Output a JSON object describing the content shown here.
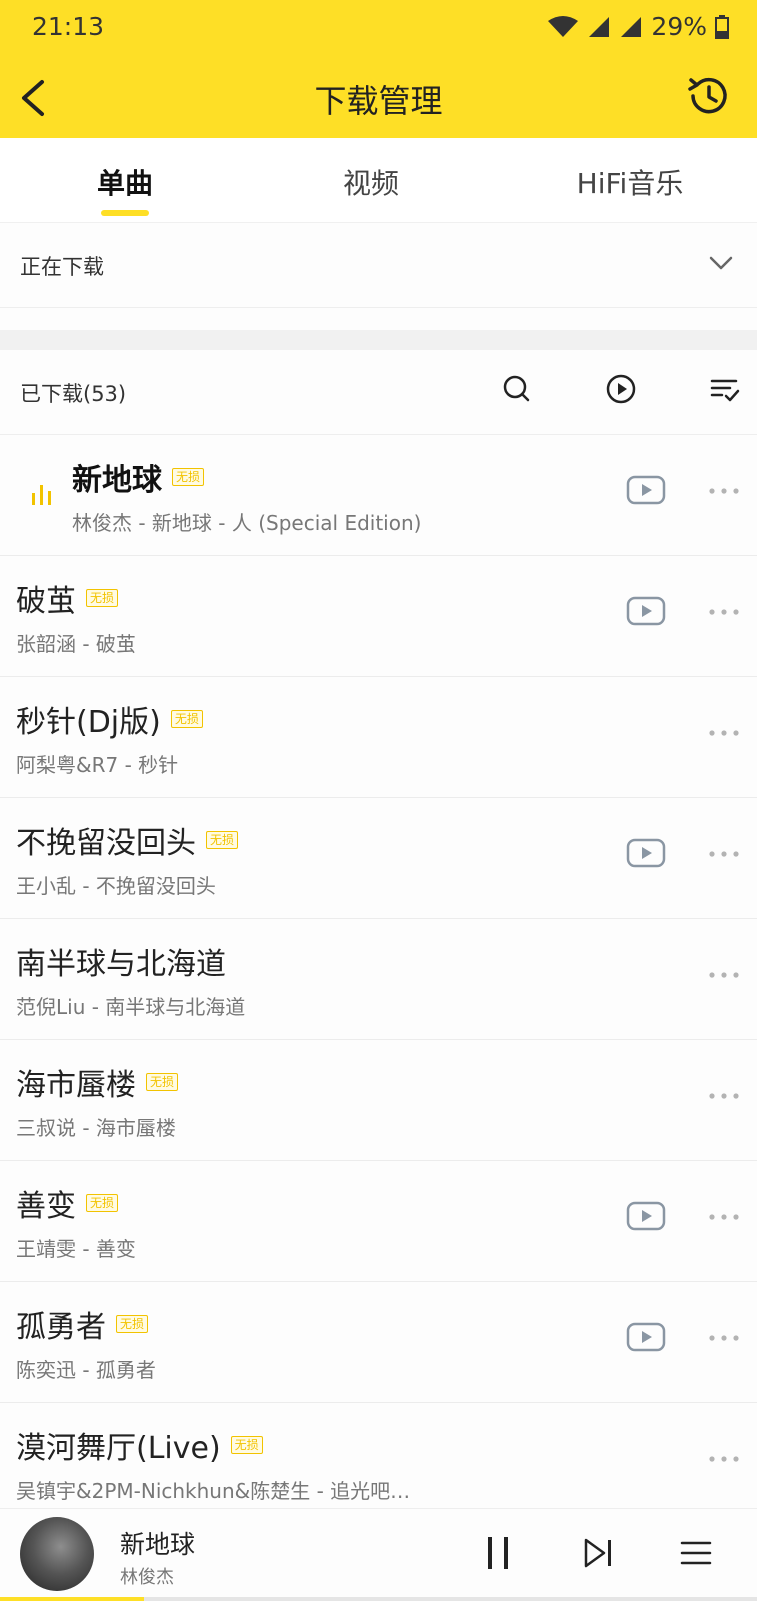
{
  "status": {
    "time": "21:13",
    "battery": "29%"
  },
  "header": {
    "title": "下载管理",
    "back_icon": "chevron-left-icon",
    "history_icon": "history-icon"
  },
  "tabs": [
    {
      "label": "单曲",
      "active": true
    },
    {
      "label": "视频",
      "active": false
    },
    {
      "label": "HiFi音乐",
      "active": false
    }
  ],
  "downloading": {
    "label": "正在下载"
  },
  "downloaded": {
    "label": "已下载(53)"
  },
  "badge_label": "无损",
  "songs": [
    {
      "title": "新地球",
      "lossless": true,
      "subtitle": "林俊杰 - 新地球 - 人 (Special Edition)",
      "mv": true,
      "playing": true
    },
    {
      "title": "破茧",
      "lossless": true,
      "subtitle": "张韶涵 - 破茧",
      "mv": true,
      "playing": false
    },
    {
      "title": "秒针(Dj版)",
      "lossless": true,
      "subtitle": "阿梨粤&R7 - 秒针",
      "mv": false,
      "playing": false
    },
    {
      "title": "不挽留没回头",
      "lossless": true,
      "subtitle": "王小乱 - 不挽留没回头",
      "mv": true,
      "playing": false
    },
    {
      "title": "南半球与北海道",
      "lossless": false,
      "subtitle": "范倪Liu - 南半球与北海道",
      "mv": false,
      "playing": false
    },
    {
      "title": "海市蜃楼",
      "lossless": true,
      "subtitle": "三叔说 - 海市蜃楼",
      "mv": false,
      "playing": false
    },
    {
      "title": "善变",
      "lossless": true,
      "subtitle": "王靖雯 - 善变",
      "mv": true,
      "playing": false
    },
    {
      "title": "孤勇者",
      "lossless": true,
      "subtitle": "陈奕迅 - 孤勇者",
      "mv": true,
      "playing": false
    },
    {
      "title": "漠河舞厅(Live)",
      "lossless": true,
      "subtitle": "吴镇宇&2PM-Nichkhun&陈楚生 - 追光吧…",
      "mv": false,
      "playing": false
    }
  ],
  "player": {
    "title": "新地球",
    "artist": "林俊杰",
    "progress": 0.19
  },
  "colors": {
    "accent": "#fedf26",
    "badge": "#f2c300"
  }
}
